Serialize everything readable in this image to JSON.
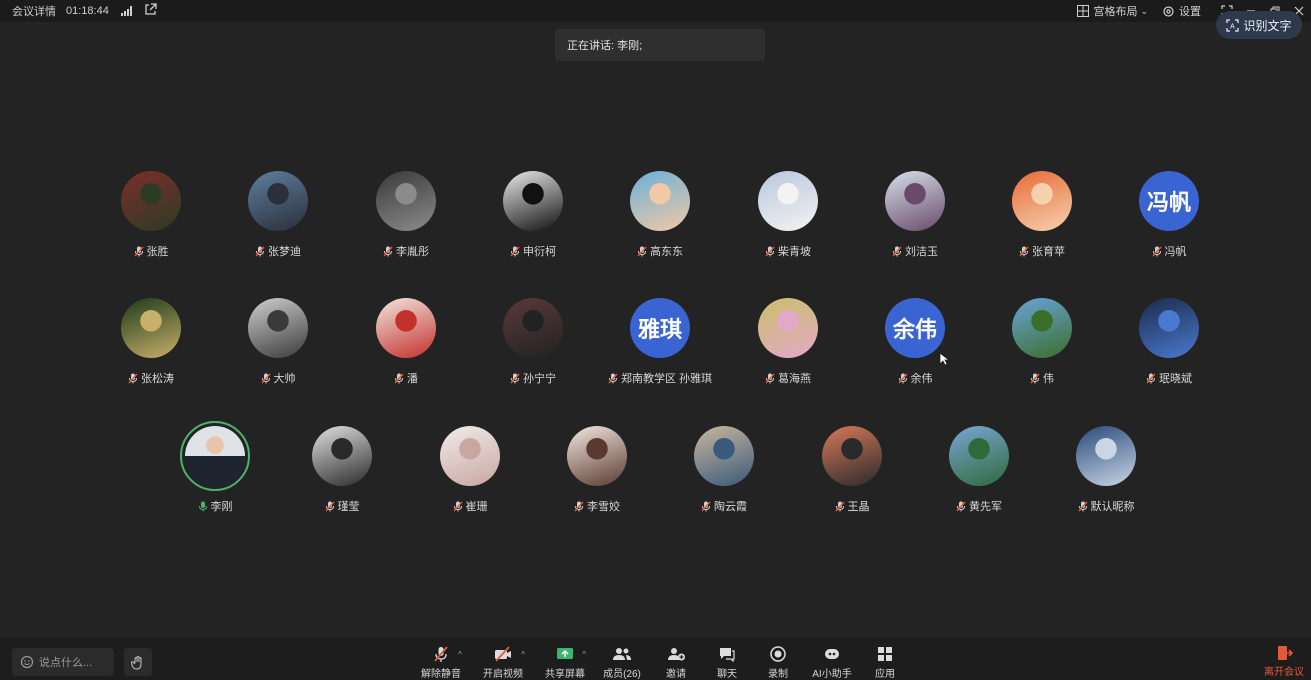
{
  "topbar": {
    "meeting_details": "会议详情",
    "elapsed": "01:18:44",
    "layout_label": "宫格布局",
    "settings_label": "设置"
  },
  "ocr_button": "识别文字",
  "speaking": "正在讲话: 李刚;",
  "participants": [
    {
      "name": "张胜",
      "avatar": "photo"
    },
    {
      "name": "张梦迪",
      "avatar": "photo"
    },
    {
      "name": "李胤彤",
      "avatar": "photo"
    },
    {
      "name": "申衍柯",
      "avatar": "photo"
    },
    {
      "name": "高东东",
      "avatar": "photo"
    },
    {
      "name": "柴青坡",
      "avatar": "photo"
    },
    {
      "name": "刘洁玉",
      "avatar": "photo"
    },
    {
      "name": "张育苹",
      "avatar": "photo"
    },
    {
      "name": "冯帆",
      "avatar": "text",
      "avatar_text": "冯帆"
    },
    {
      "name": "张松涛",
      "avatar": "photo"
    },
    {
      "name": "大帅",
      "avatar": "photo"
    },
    {
      "name": "潘",
      "avatar": "photo"
    },
    {
      "name": "孙宁宁",
      "avatar": "photo"
    },
    {
      "name": "郑南教学区 孙雅琪",
      "avatar": "text",
      "avatar_text": "雅琪"
    },
    {
      "name": "葛海燕",
      "avatar": "photo"
    },
    {
      "name": "余伟",
      "avatar": "text",
      "avatar_text": "余伟"
    },
    {
      "name": "伟",
      "avatar": "photo"
    },
    {
      "name": "珉晓斌",
      "avatar": "photo"
    },
    {
      "name": "李刚",
      "avatar": "photo",
      "speaking": true
    },
    {
      "name": "瑾莹",
      "avatar": "photo"
    },
    {
      "name": "崔珊",
      "avatar": "photo"
    },
    {
      "name": "李雪姣",
      "avatar": "photo"
    },
    {
      "name": "陶云霞",
      "avatar": "photo"
    },
    {
      "name": "王晶",
      "avatar": "photo"
    },
    {
      "name": "黄先军",
      "avatar": "photo"
    },
    {
      "name": "默认昵称",
      "avatar": "photo"
    }
  ],
  "bottombar": {
    "chat_placeholder": "说点什么...",
    "unmute": "解除静音",
    "start_video": "开启视频",
    "share_screen": "共享屏幕",
    "members": "成员(26)",
    "invite": "邀请",
    "chat": "聊天",
    "record": "录制",
    "ai_assistant": "AI小助手",
    "apps": "应用",
    "leave": "离开会议"
  },
  "colors": {
    "background": "#232323",
    "text_avatar": "#3a64d1",
    "speaking_ring": "#49b36f",
    "leave": "#e05a3c"
  }
}
